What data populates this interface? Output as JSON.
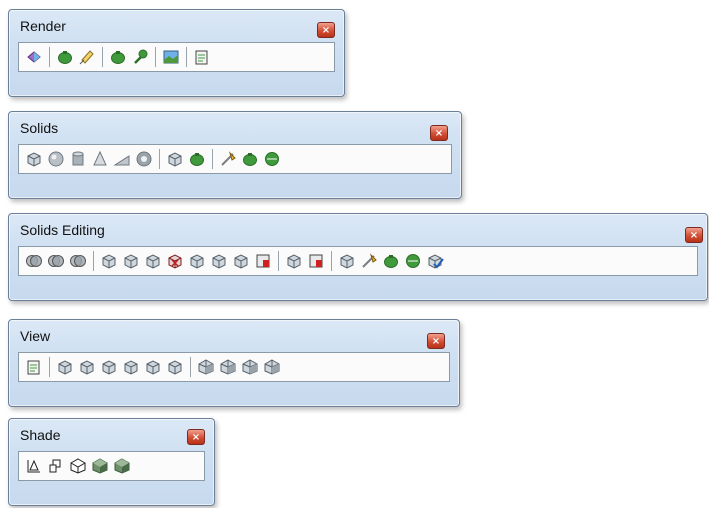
{
  "toolbars": {
    "render": {
      "title": "Render",
      "close": "×",
      "groups": [
        [
          "render-cube-icon"
        ],
        [
          "teapot-icon",
          "light-icon"
        ],
        [
          "scene-icon",
          "material-icon"
        ],
        [
          "landscape-icon"
        ],
        [
          "statistics-icon"
        ]
      ]
    },
    "solids": {
      "title": "Solids",
      "close": "×",
      "groups": [
        [
          "box-icon",
          "sphere-icon",
          "cylinder-icon",
          "cone-icon",
          "wedge-icon",
          "torus-icon"
        ],
        [
          "extrude-icon",
          "revolve-icon"
        ],
        [
          "slice-icon",
          "section-icon",
          "interference-icon"
        ]
      ]
    },
    "solids_editing": {
      "title": "Solids Editing",
      "close": "×",
      "groups": [
        [
          "union-icon",
          "subtract-icon",
          "intersect-icon"
        ],
        [
          "extrude-faces-icon",
          "move-faces-icon",
          "offset-faces-icon",
          "delete-faces-icon",
          "rotate-faces-icon",
          "taper-faces-icon",
          "copy-faces-icon",
          "color-faces-icon"
        ],
        [
          "copy-edges-icon",
          "color-edges-icon"
        ],
        [
          "imprint-icon",
          "clean-icon",
          "separate-icon",
          "shell-icon",
          "check-icon"
        ]
      ]
    },
    "view": {
      "title": "View",
      "close": "×",
      "groups": [
        [
          "named-views-icon"
        ],
        [
          "top-view-icon",
          "bottom-view-icon",
          "left-view-icon",
          "right-view-icon",
          "front-view-icon",
          "back-view-icon"
        ],
        [
          "sw-iso-icon",
          "se-iso-icon",
          "ne-iso-icon",
          "nw-iso-icon"
        ]
      ]
    },
    "shade": {
      "title": "Shade",
      "close": "×",
      "groups": [
        [
          "2d-wireframe-icon",
          "3d-wireframe-icon",
          "hidden-icon",
          "flat-shaded-icon",
          "gouraud-shaded-icon"
        ]
      ]
    }
  },
  "colors": {
    "titlebar": "#cfe0f2",
    "close": "#d24f36",
    "icon_green": "#3f9a3c",
    "icon_gray": "#8b949c"
  }
}
